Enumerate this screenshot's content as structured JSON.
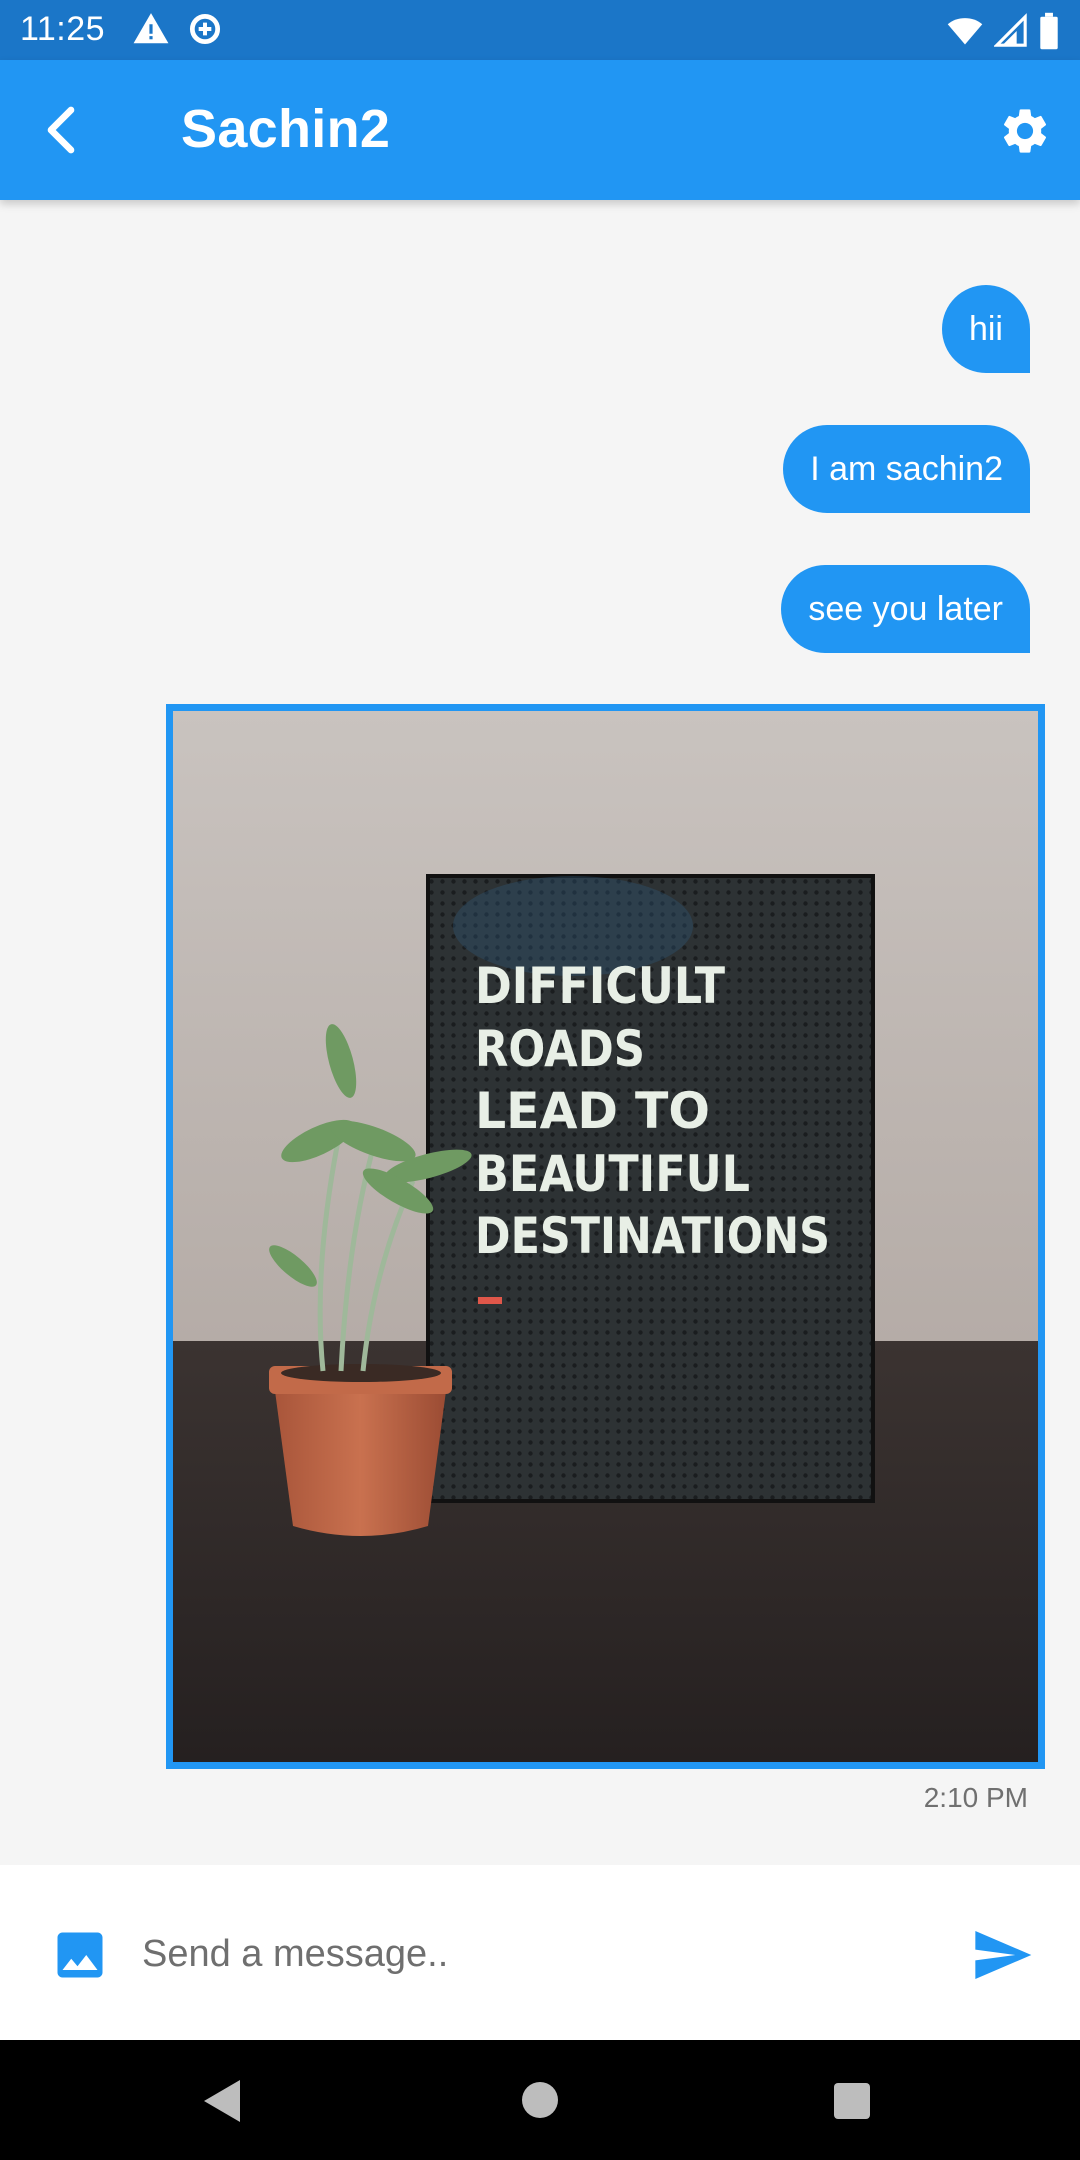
{
  "status_bar": {
    "time": "11:25",
    "left_icons": [
      "warning-icon",
      "data-saver-icon"
    ],
    "right_icons": [
      "wifi-icon",
      "cell-signal-icon",
      "battery-icon"
    ]
  },
  "app_bar": {
    "title": "Sachin2",
    "back_icon": "arrow-back-icon",
    "settings_icon": "gear-icon",
    "background": "#2196F3"
  },
  "messages": [
    {
      "type": "text",
      "text": "hii",
      "sender": "me"
    },
    {
      "type": "text",
      "text": "I am sachin2",
      "sender": "me"
    },
    {
      "type": "text",
      "text": "see you later",
      "sender": "me"
    },
    {
      "type": "image",
      "sender": "me",
      "image_text": [
        "DIFFICULT",
        "ROADS",
        "LEAD TO",
        "BEAUTIFUL",
        "DESTINATIONS"
      ],
      "time": "2:10 PM"
    }
  ],
  "composer": {
    "placeholder": "Send a message..",
    "value": "",
    "gallery_icon": "image-icon",
    "send_icon": "send-icon"
  },
  "nav_bar": {
    "icons": [
      "nav-back-icon",
      "nav-home-icon",
      "nav-recents-icon"
    ]
  },
  "colors": {
    "accent": "#2196F3",
    "status_bar": "#1B76C8",
    "background": "#F5F5F5"
  }
}
